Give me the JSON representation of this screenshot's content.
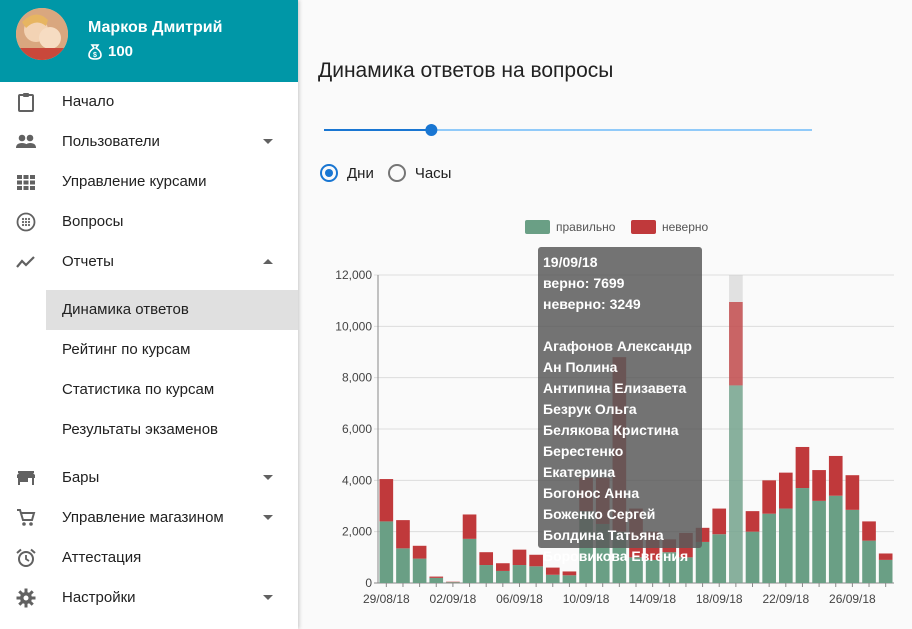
{
  "profile": {
    "name": "Марков Дмитрий",
    "coins": "100"
  },
  "menu": {
    "items": [
      {
        "label": "Начало",
        "icon": "clipboard-icon"
      },
      {
        "label": "Пользователи",
        "icon": "people-icon",
        "expandable": true
      },
      {
        "label": "Управление курсами",
        "icon": "grid-icon"
      },
      {
        "label": "Вопросы",
        "icon": "dots-circle-icon"
      },
      {
        "label": "Отчеты",
        "icon": "trend-icon",
        "expanded": true
      }
    ],
    "sub_items": [
      {
        "label": "Динамика ответов",
        "active": true
      },
      {
        "label": "Рейтинг по курсам"
      },
      {
        "label": "Статистика по курсам"
      },
      {
        "label": "Результаты экзаменов"
      }
    ],
    "items_after": [
      {
        "label": "Бары",
        "icon": "store-icon",
        "expandable": true
      },
      {
        "label": "Управление магазином",
        "icon": "cart-icon",
        "expandable": true
      },
      {
        "label": "Аттестация",
        "icon": "alarm-icon"
      },
      {
        "label": "Настройки",
        "icon": "gear-icon",
        "expandable": true
      }
    ]
  },
  "main": {
    "title": "Динамика ответов на вопросы",
    "slider_value_fraction": 0.22,
    "radios": {
      "days": "Дни",
      "hours": "Часы",
      "selected": "days"
    }
  },
  "tooltip": {
    "date": "19/09/18",
    "correct_label": "верно:",
    "correct_value": "7699",
    "wrong_label": "неверно:",
    "wrong_value": "3249",
    "names": [
      "Агафонов Александр",
      "Ан Полина",
      "Антипина Елизавета",
      "Безрук Ольга",
      "Белякова Кристина",
      "Берестенко Екатерина",
      "Богонос Анна",
      "Боженко Сергей",
      "Болдина Татьяна",
      "Боровикова Евгения"
    ]
  },
  "colors": {
    "accent": "#0097a7",
    "correct": "#6a9f85",
    "wrong": "#c0393b",
    "slider": "#1976d2"
  },
  "chart_data": {
    "type": "bar",
    "stacked": true,
    "categories": [
      "29/08/18",
      "30/08/18",
      "31/08/18",
      "01/09/18",
      "02/09/18",
      "03/09/18",
      "04/09/18",
      "05/09/18",
      "06/09/18",
      "07/09/18",
      "08/09/18",
      "09/09/18",
      "10/09/18",
      "11/09/18",
      "12/09/18",
      "13/09/18",
      "14/09/18",
      "15/09/18",
      "16/09/18",
      "17/09/18",
      "18/09/18",
      "19/09/18",
      "20/09/18",
      "21/09/18",
      "22/09/18",
      "23/09/18",
      "24/09/18",
      "25/09/18",
      "26/09/18",
      "27/09/18",
      "28/09/18"
    ],
    "x_tick_labels": [
      "29/08/18",
      "02/09/18",
      "06/09/18",
      "10/09/18",
      "14/09/18",
      "18/09/18",
      "22/09/18",
      "26/09/18"
    ],
    "series": [
      {
        "name": "правильно",
        "color": "#6a9f85",
        "values": [
          2400,
          1350,
          950,
          200,
          30,
          1720,
          700,
          470,
          700,
          650,
          320,
          300,
          2800,
          2300,
          2000,
          1000,
          900,
          1200,
          1000,
          1600,
          1900,
          7699,
          2000,
          2700,
          2900,
          3700,
          3200,
          3400,
          2850,
          1650,
          900
        ]
      },
      {
        "name": "неверно",
        "color": "#c0393b",
        "values": [
          1650,
          1100,
          500,
          50,
          20,
          950,
          500,
          300,
          600,
          450,
          280,
          150,
          1300,
          1800,
          6800,
          1900,
          1100,
          500,
          950,
          550,
          1000,
          3249,
          800,
          1300,
          1400,
          1600,
          1200,
          1550,
          1350,
          750,
          250
        ]
      }
    ],
    "ylim": [
      0,
      12000
    ],
    "yticks": [
      "0",
      "2,000",
      "4,000",
      "6,000",
      "8,000",
      "10,000",
      "12,000"
    ],
    "highlight_index": 21,
    "legend": "top-center",
    "grid": true
  }
}
